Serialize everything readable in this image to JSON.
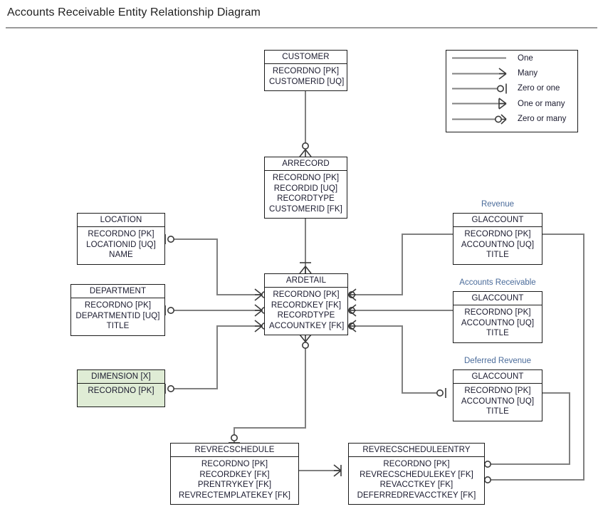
{
  "page": {
    "title": "Accounts Receivable Entity Relationship Diagram"
  },
  "legend": {
    "items": [
      {
        "label": "One",
        "symbol": "one-line"
      },
      {
        "label": "Many",
        "symbol": "crowsfoot"
      },
      {
        "label": "Zero or one",
        "symbol": "circle-bar"
      },
      {
        "label": "One or many",
        "symbol": "bar-crowsfoot"
      },
      {
        "label": "Zero or many",
        "symbol": "circle-crowsfoot"
      }
    ]
  },
  "entities": [
    {
      "id": "customer",
      "name": "CUSTOMER",
      "attributes": [
        "RECORDNO [PK]",
        "CUSTOMERID [UQ]"
      ],
      "group_label": null,
      "highlight": false
    },
    {
      "id": "arrecord",
      "name": "ARRECORD",
      "attributes": [
        "RECORDNO [PK]",
        "RECORDID [UQ]",
        "RECORDTYPE",
        "CUSTOMERID [FK]"
      ],
      "group_label": null,
      "highlight": false
    },
    {
      "id": "ardetail",
      "name": "ARDETAIL",
      "attributes": [
        "RECORDNO [PK]",
        "RECORDKEY [FK]",
        "RECORDTYPE",
        "ACCOUNTKEY [FK]"
      ],
      "group_label": null,
      "highlight": false
    },
    {
      "id": "location",
      "name": "LOCATION",
      "attributes": [
        "RECORDNO [PK]",
        "LOCATIONID [UQ]",
        "NAME"
      ],
      "group_label": null,
      "highlight": false
    },
    {
      "id": "department",
      "name": "DEPARTMENT",
      "attributes": [
        "RECORDNO [PK]",
        "DEPARTMENTID [UQ]",
        "TITLE"
      ],
      "group_label": null,
      "highlight": false
    },
    {
      "id": "dimension",
      "name": "DIMENSION [X]",
      "attributes": [
        "RECORDNO [PK]"
      ],
      "group_label": null,
      "highlight": true
    },
    {
      "id": "glaccount-revenue",
      "name": "GLACCOUNT",
      "attributes": [
        "RECORDNO [PK]",
        "ACCOUNTNO [UQ]",
        "TITLE"
      ],
      "group_label": "Revenue",
      "highlight": false
    },
    {
      "id": "glaccount-ar",
      "name": "GLACCOUNT",
      "attributes": [
        "RECORDNO [PK]",
        "ACCOUNTNO [UQ]",
        "TITLE"
      ],
      "group_label": "Accounts Receivable",
      "highlight": false
    },
    {
      "id": "glaccount-deferred",
      "name": "GLACCOUNT",
      "attributes": [
        "RECORDNO [PK]",
        "ACCOUNTNO [UQ]",
        "TITLE"
      ],
      "group_label": "Deferred Revenue",
      "highlight": false
    },
    {
      "id": "revrecschedule",
      "name": "REVRECSCHEDULE",
      "attributes": [
        "RECORDNO [PK]",
        "RECORDKEY [FK]",
        "PRENTRYKEY [FK]",
        "REVRECTEMPLATEKEY [FK]"
      ],
      "group_label": null,
      "highlight": false
    },
    {
      "id": "revrecscheduleentry",
      "name": "REVRECSCHEDULEENTRY",
      "attributes": [
        "RECORDNO [PK]",
        "REVRECSCHEDULEKEY [FK]",
        "REVACCTKEY [FK]",
        "DEFERREDREVACCTKEY [FK]"
      ],
      "group_label": null,
      "highlight": false
    }
  ],
  "relationships": [
    {
      "from": "customer",
      "to": "arrecord",
      "to_cardinality": "zero or many"
    },
    {
      "from": "arrecord",
      "to": "ardetail",
      "to_cardinality": "one or many"
    },
    {
      "from": "location",
      "to": "ardetail",
      "from_cardinality": "zero or one",
      "to_cardinality": "zero or many"
    },
    {
      "from": "department",
      "to": "ardetail",
      "from_cardinality": "zero or one",
      "to_cardinality": "zero or many"
    },
    {
      "from": "dimension",
      "to": "ardetail",
      "from_cardinality": "zero or one",
      "to_cardinality": "zero or many"
    },
    {
      "from": "ardetail",
      "to": "glaccount-revenue",
      "from_cardinality": "zero or many"
    },
    {
      "from": "ardetail",
      "to": "glaccount-ar",
      "from_cardinality": "zero or many"
    },
    {
      "from": "ardetail",
      "to": "glaccount-deferred",
      "from_cardinality": "zero or many"
    },
    {
      "from": "ardetail",
      "to": "revrecschedule",
      "from_cardinality": "zero or many",
      "to_cardinality": "zero or one"
    },
    {
      "from": "revrecschedule",
      "to": "revrecscheduleentry",
      "to_cardinality": "one or many"
    },
    {
      "from": "revrecscheduleentry",
      "to": "glaccount-revenue",
      "from_cardinality": "zero or many"
    },
    {
      "from": "revrecscheduleentry",
      "to": "glaccount-deferred",
      "from_cardinality": "zero or many"
    }
  ],
  "colors": {
    "line": "#808080",
    "border": "#1b1b1b",
    "highlight_fill": "#dfecd5",
    "group_label": "#4a6b9a",
    "title_rule": "#9a9a9a"
  }
}
